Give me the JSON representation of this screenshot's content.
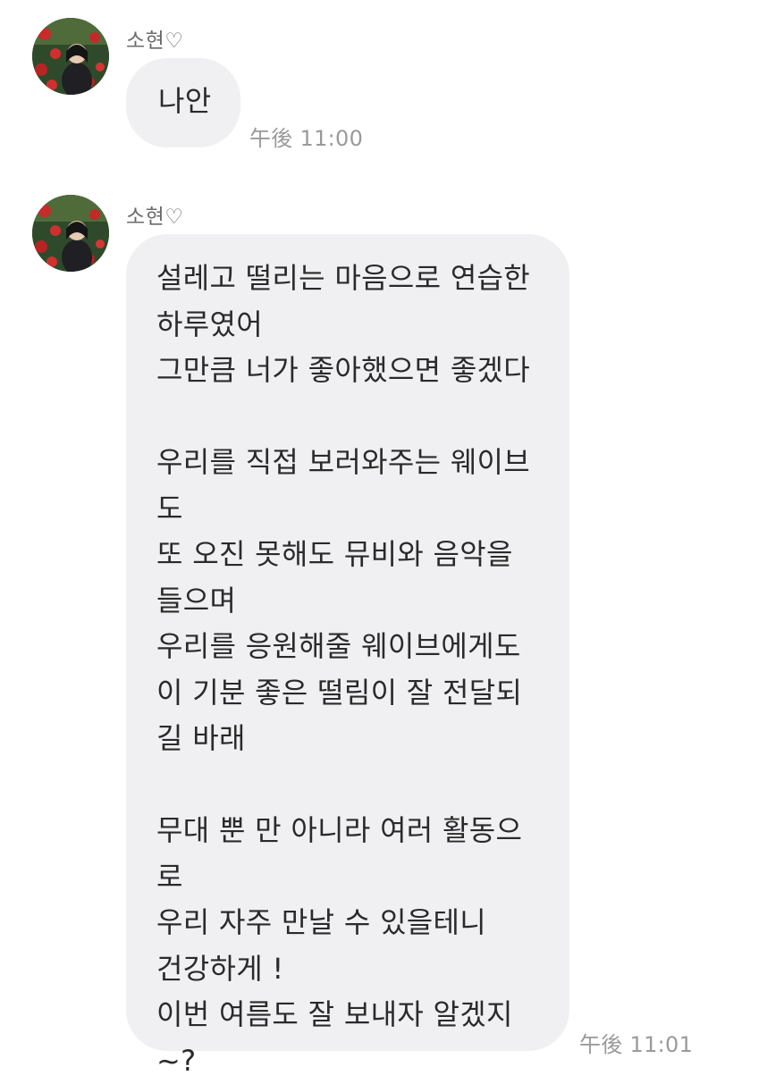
{
  "chat": {
    "messages": [
      {
        "sender": "소현♡",
        "text": "나안",
        "time": "午後 11:00"
      },
      {
        "sender": "소현♡",
        "text": "설레고 떨리는 마음으로 연습한\n하루였어\n그만큼 너가 좋아했으면 좋겠다\n\n우리를 직접 보러와주는 웨이브\n도\n또 오진 못해도 뮤비와 음악을\n들으며\n우리를 응원해줄 웨이브에게도\n이 기분 좋은 떨림이 잘 전달되\n길 바래\n\n무대 뿐 만 아니라 여러 활동으\n로\n우리 자주 만날 수 있을테니\n건강하게 !\n이번 여름도 잘 보내자 알겠지\n~?",
        "time": "午後 11:01"
      }
    ],
    "avatar_icon": "profile-photo-roses",
    "colors": {
      "bubble": "#f0f0f3",
      "sender": "#6b6b6b",
      "timestamp": "#9a9a9a",
      "text": "#2a2a2a"
    }
  }
}
